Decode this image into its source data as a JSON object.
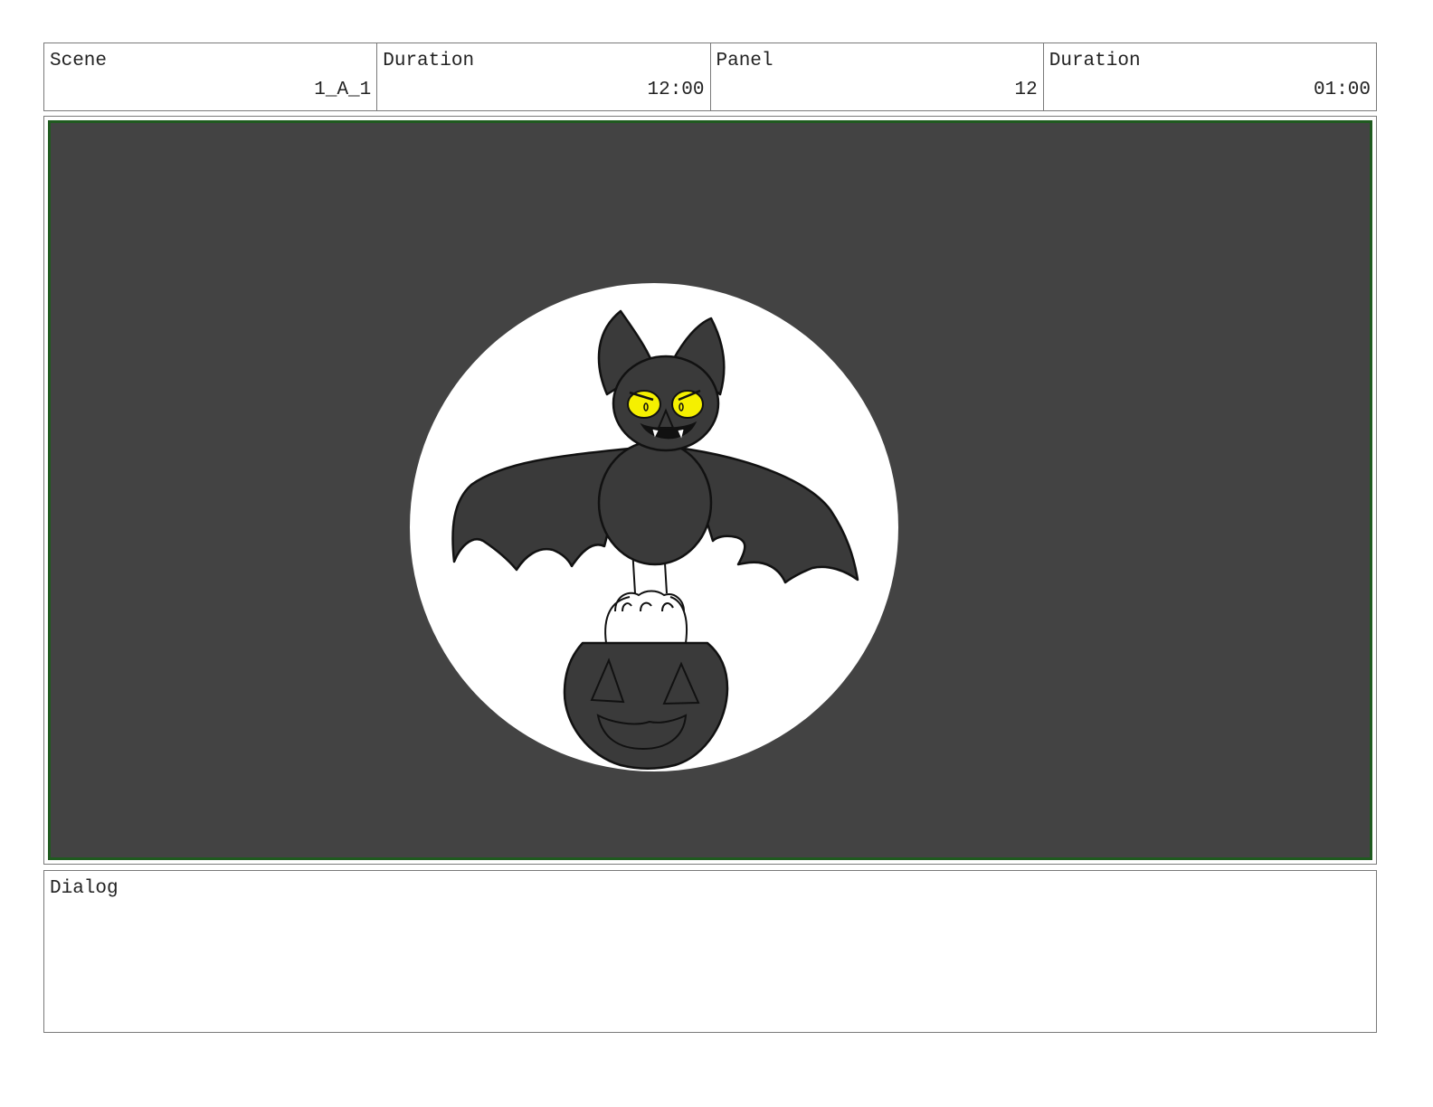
{
  "header": {
    "scene_label": "Scene",
    "scene_value": "1_A_1",
    "scene_duration_label": "Duration",
    "scene_duration_value": "12:00",
    "panel_label": "Panel",
    "panel_value": "12",
    "panel_duration_label": "Duration",
    "panel_duration_value": "01:00"
  },
  "panel": {
    "background_color": "#434343",
    "moon_color": "#ffffff",
    "bat_color": "#3a3a3a",
    "eye_color": "#f5f000",
    "frame_color": "#1f5a1f"
  },
  "dialog": {
    "label": "Dialog",
    "text": ""
  }
}
